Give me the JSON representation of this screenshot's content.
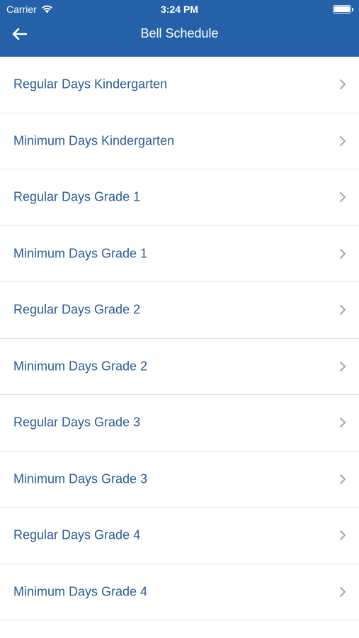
{
  "status_bar": {
    "carrier": "Carrier",
    "time": "3:24 PM"
  },
  "nav": {
    "title": "Bell Schedule",
    "back_icon": "arrow-left-icon"
  },
  "colors": {
    "header_bg": "#2461a8",
    "item_text": "#2a5c94",
    "chevron": "#9aa9ba",
    "divider": "#e3e3e3"
  },
  "schedule_list": {
    "items": [
      {
        "label": "Regular Days Kindergarten"
      },
      {
        "label": "Minimum Days Kindergarten"
      },
      {
        "label": "Regular Days Grade 1"
      },
      {
        "label": "Minimum Days Grade 1"
      },
      {
        "label": "Regular Days Grade 2"
      },
      {
        "label": "Minimum Days Grade 2"
      },
      {
        "label": "Regular Days Grade 3"
      },
      {
        "label": "Minimum Days Grade 3"
      },
      {
        "label": "Regular Days Grade 4"
      },
      {
        "label": "Minimum Days Grade 4"
      }
    ]
  }
}
